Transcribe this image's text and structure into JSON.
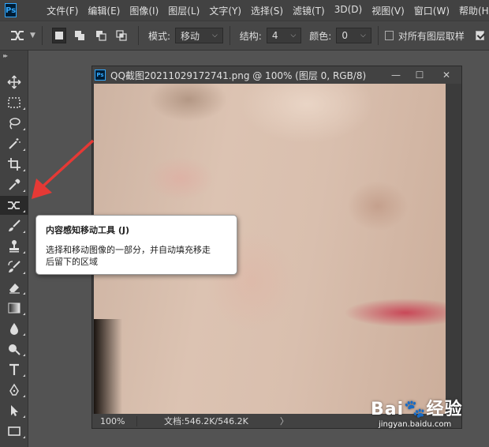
{
  "app": {
    "logo": "Ps"
  },
  "menu": [
    "文件(F)",
    "编辑(E)",
    "图像(I)",
    "图层(L)",
    "文字(Y)",
    "选择(S)",
    "滤镜(T)",
    "3D(D)",
    "视图(V)",
    "窗口(W)",
    "帮助(H)"
  ],
  "options": {
    "mode_label": "模式:",
    "mode_value": "移动",
    "structure_label": "结构:",
    "structure_value": "4",
    "color_label": "颜色:",
    "color_value": "0",
    "sample_all_layers": "对所有图层取样"
  },
  "document": {
    "title": "QQ截图20211029172741.png @ 100% (图层 0, RGB/8)",
    "zoom": "100%",
    "doc_info": "文档:546.2K/546.2K",
    "status_arrow": "〉"
  },
  "tooltip": {
    "title": "内容感知移动工具 (J)",
    "body_line1": "选择和移动图像的一部分，并自动填充移走",
    "body_line2": "后留下的区域"
  },
  "watermark": {
    "brand": "Bai🐾经验",
    "url": "jingyan.baidu.com"
  },
  "colors": {
    "accent": "#31a8ff",
    "arrow": "#e53935"
  }
}
